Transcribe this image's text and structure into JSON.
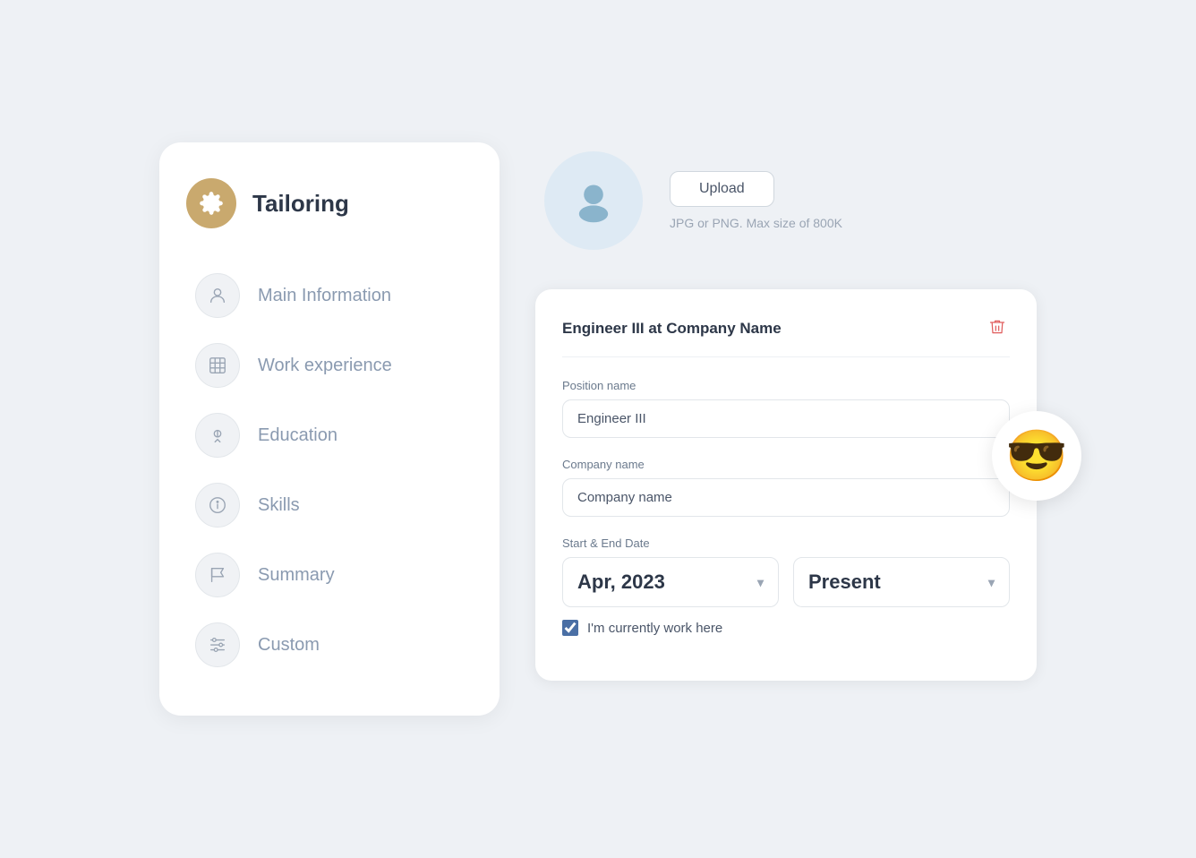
{
  "sidebar": {
    "header": {
      "title": "Tailoring",
      "icon": "gear"
    },
    "items": [
      {
        "id": "main-info",
        "label": "Main Information",
        "icon": "person"
      },
      {
        "id": "work-experience",
        "label": "Work experience",
        "icon": "building"
      },
      {
        "id": "education",
        "label": "Education",
        "icon": "certificate"
      },
      {
        "id": "skills",
        "label": "Skills",
        "icon": "info-circle"
      },
      {
        "id": "summary",
        "label": "Summary",
        "icon": "flag"
      },
      {
        "id": "custom",
        "label": "Custom",
        "icon": "sliders"
      }
    ]
  },
  "upload": {
    "button_label": "Upload",
    "hint": "JPG or PNG. Max size of 800K"
  },
  "form_card": {
    "title": "Engineer III at Company Name",
    "fields": {
      "position_name": {
        "label": "Position name",
        "value": "Engineer III",
        "placeholder": "Engineer III"
      },
      "company_name": {
        "label": "Company name",
        "value": "Company name",
        "placeholder": "Company name"
      },
      "date_range": {
        "label": "Start & End Date",
        "start": "Apr, 2023",
        "end": "Present"
      },
      "currently_working": {
        "label": "I'm currently work here",
        "checked": true
      }
    }
  },
  "emoji": "😎"
}
